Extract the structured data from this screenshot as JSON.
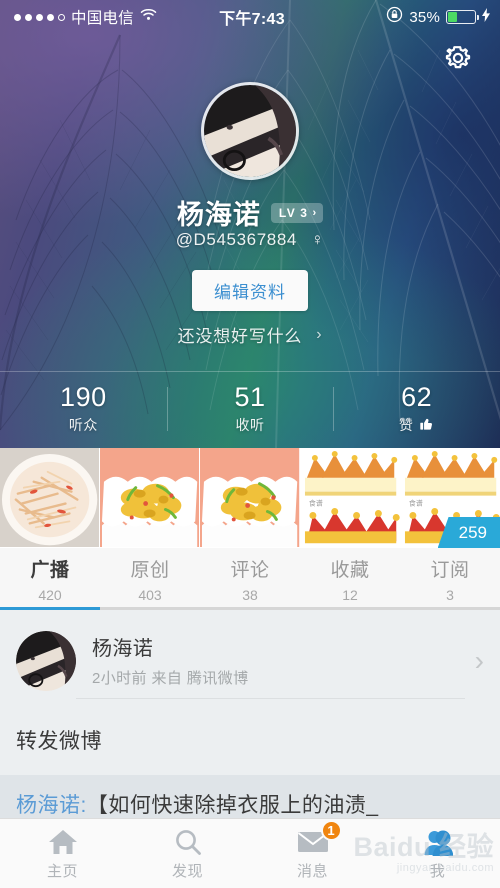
{
  "statusbar": {
    "signal_dots_filled": 4,
    "signal_dots_total": 5,
    "carrier": "中国电信",
    "wifi_icon": "wifi-icon",
    "time": "下午7:43",
    "rotation_lock_icon": "rotation-lock-icon",
    "battery_pct": "35%",
    "charging_icon": "lightning-bolt-icon"
  },
  "hero": {
    "settings_icon": "gear-icon",
    "avatar": "user-avatar",
    "username": "杨海诺",
    "level_badge": {
      "label": "LV",
      "level": "3",
      "chevron": "›"
    },
    "user_id": "@D545367884",
    "gender_icon": "♀",
    "edit_profile_label": "编辑资料",
    "signature": "还没想好写什么",
    "signature_chevron": "›",
    "stats": [
      {
        "value": "190",
        "label": "听众",
        "icon": ""
      },
      {
        "value": "51",
        "label": "收听",
        "icon": ""
      },
      {
        "value": "62",
        "label": "赞",
        "icon": "thumbs-up-icon"
      }
    ]
  },
  "photostrip": {
    "count_badge": "259",
    "photos": [
      {
        "name": "shredded-potato-dish"
      },
      {
        "name": "scrambled-egg-dish"
      },
      {
        "name": "scrambled-egg-dish-2"
      },
      {
        "name": "crown-graphic"
      },
      {
        "name": "crown-graphic-2"
      }
    ]
  },
  "tabs": [
    {
      "label": "广播",
      "count": "420",
      "active": true
    },
    {
      "label": "原创",
      "count": "403",
      "active": false
    },
    {
      "label": "评论",
      "count": "38",
      "active": false
    },
    {
      "label": "收藏",
      "count": "12",
      "active": false
    },
    {
      "label": "订阅",
      "count": "3",
      "active": false
    }
  ],
  "feed": {
    "post": {
      "author": "杨海诺",
      "meta": "2小时前  来自 腾讯微博",
      "chevron": "›",
      "body": "转发微博",
      "quote_name": "杨海诺:",
      "quote_text": "【如何快速除掉衣服上的油渍_"
    }
  },
  "bottomnav": [
    {
      "label": "主页",
      "icon": "home-icon",
      "active": false,
      "badge": ""
    },
    {
      "label": "发现",
      "icon": "search-icon",
      "active": false,
      "badge": ""
    },
    {
      "label": "消息",
      "icon": "envelope-icon",
      "active": false,
      "badge": "1"
    },
    {
      "label": "我",
      "icon": "person-icon",
      "active": true,
      "badge": ""
    }
  ],
  "watermark": {
    "line1": "Baidu 经验",
    "line2": "jingyan.baidu.com"
  },
  "colors": {
    "accent_blue": "#2e9ad6",
    "badge_cyan": "#2aa9d8",
    "badge_orange": "#f0850f",
    "link_blue": "#5b9bd5",
    "battery_green": "#4cd964"
  }
}
